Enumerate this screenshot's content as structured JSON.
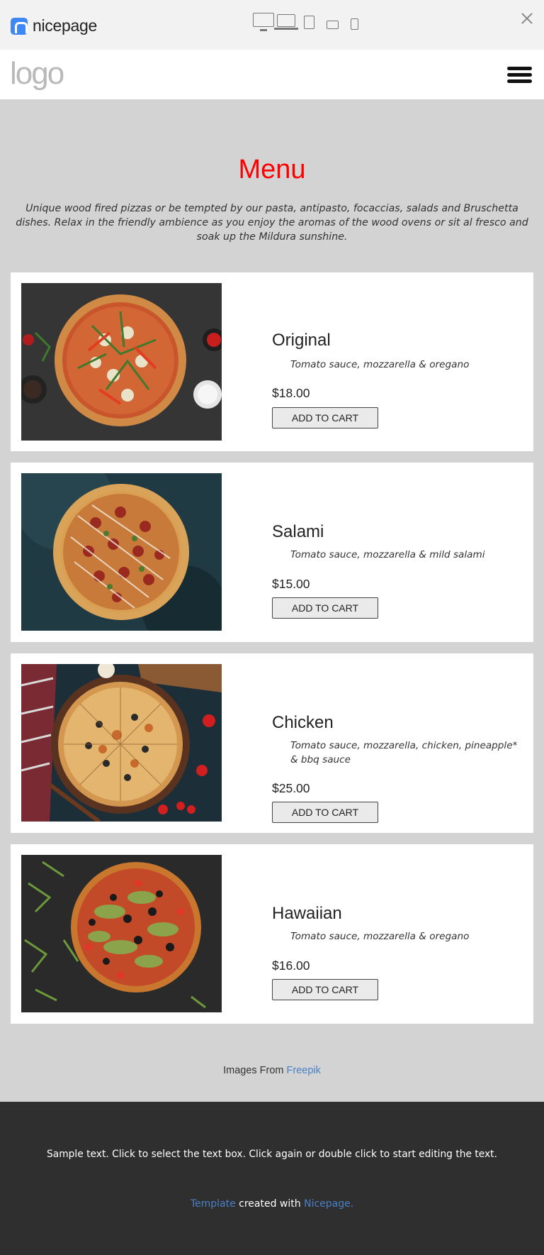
{
  "editor_bar": {
    "brand": "nicepage",
    "devices": [
      "desktop-icon",
      "laptop-icon",
      "tablet-icon",
      "tablet-landscape-icon",
      "phone-icon"
    ],
    "close_icon": "close-icon"
  },
  "header": {
    "logo": "logo",
    "menu_icon": "hamburger-menu-icon"
  },
  "menu": {
    "title": "Menu",
    "intro": "Unique wood fired pizzas or be tempted by our pasta, antipasto, focaccias, salads and Bruschetta dishes. Relax in the friendly ambience as you enjoy the aromas of the wood ovens or sit al fresco and soak up the Mildura sunshine.",
    "items": [
      {
        "name": "Original",
        "description": "Tomato sauce, mozzarella & oregano",
        "price": "$18.00",
        "button": "ADD TO CART"
      },
      {
        "name": "Salami",
        "description": "Tomato sauce, mozzarella & mild salami",
        "price": "$15.00",
        "button": "ADD TO CART"
      },
      {
        "name": "Chicken",
        "description": "Tomato sauce, mozzarella, chicken, pineapple* & bbq sauce",
        "price": "$25.00",
        "button": "ADD TO CART"
      },
      {
        "name": "Hawaiian",
        "description": "Tomato sauce, mozzarella & oregano",
        "price": "$16.00",
        "button": "ADD TO CART"
      }
    ]
  },
  "credit": {
    "prefix": "Images From",
    "link": "Freepik"
  },
  "footer": {
    "text": "Sample text. Click to select the text box. Click again or double click to start editing the text.",
    "template_link": "Template",
    "middle": "created with",
    "nicepage_link": "Nicepage."
  },
  "colors": {
    "accent_title": "#ff0000",
    "link": "#4a80c6",
    "page_bg": "#d3d3d3",
    "footer_bg": "#2f2f2f",
    "brand_blue": "#3f87f5"
  }
}
